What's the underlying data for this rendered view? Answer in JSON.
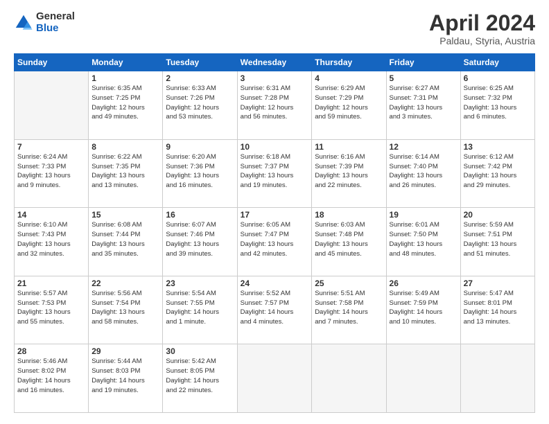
{
  "logo": {
    "general": "General",
    "blue": "Blue"
  },
  "title": "April 2024",
  "subtitle": "Paldau, Styria, Austria",
  "days_header": [
    "Sunday",
    "Monday",
    "Tuesday",
    "Wednesday",
    "Thursday",
    "Friday",
    "Saturday"
  ],
  "weeks": [
    [
      {
        "num": "",
        "info": ""
      },
      {
        "num": "1",
        "info": "Sunrise: 6:35 AM\nSunset: 7:25 PM\nDaylight: 12 hours\nand 49 minutes."
      },
      {
        "num": "2",
        "info": "Sunrise: 6:33 AM\nSunset: 7:26 PM\nDaylight: 12 hours\nand 53 minutes."
      },
      {
        "num": "3",
        "info": "Sunrise: 6:31 AM\nSunset: 7:28 PM\nDaylight: 12 hours\nand 56 minutes."
      },
      {
        "num": "4",
        "info": "Sunrise: 6:29 AM\nSunset: 7:29 PM\nDaylight: 12 hours\nand 59 minutes."
      },
      {
        "num": "5",
        "info": "Sunrise: 6:27 AM\nSunset: 7:31 PM\nDaylight: 13 hours\nand 3 minutes."
      },
      {
        "num": "6",
        "info": "Sunrise: 6:25 AM\nSunset: 7:32 PM\nDaylight: 13 hours\nand 6 minutes."
      }
    ],
    [
      {
        "num": "7",
        "info": "Sunrise: 6:24 AM\nSunset: 7:33 PM\nDaylight: 13 hours\nand 9 minutes."
      },
      {
        "num": "8",
        "info": "Sunrise: 6:22 AM\nSunset: 7:35 PM\nDaylight: 13 hours\nand 13 minutes."
      },
      {
        "num": "9",
        "info": "Sunrise: 6:20 AM\nSunset: 7:36 PM\nDaylight: 13 hours\nand 16 minutes."
      },
      {
        "num": "10",
        "info": "Sunrise: 6:18 AM\nSunset: 7:37 PM\nDaylight: 13 hours\nand 19 minutes."
      },
      {
        "num": "11",
        "info": "Sunrise: 6:16 AM\nSunset: 7:39 PM\nDaylight: 13 hours\nand 22 minutes."
      },
      {
        "num": "12",
        "info": "Sunrise: 6:14 AM\nSunset: 7:40 PM\nDaylight: 13 hours\nand 26 minutes."
      },
      {
        "num": "13",
        "info": "Sunrise: 6:12 AM\nSunset: 7:42 PM\nDaylight: 13 hours\nand 29 minutes."
      }
    ],
    [
      {
        "num": "14",
        "info": "Sunrise: 6:10 AM\nSunset: 7:43 PM\nDaylight: 13 hours\nand 32 minutes."
      },
      {
        "num": "15",
        "info": "Sunrise: 6:08 AM\nSunset: 7:44 PM\nDaylight: 13 hours\nand 35 minutes."
      },
      {
        "num": "16",
        "info": "Sunrise: 6:07 AM\nSunset: 7:46 PM\nDaylight: 13 hours\nand 39 minutes."
      },
      {
        "num": "17",
        "info": "Sunrise: 6:05 AM\nSunset: 7:47 PM\nDaylight: 13 hours\nand 42 minutes."
      },
      {
        "num": "18",
        "info": "Sunrise: 6:03 AM\nSunset: 7:48 PM\nDaylight: 13 hours\nand 45 minutes."
      },
      {
        "num": "19",
        "info": "Sunrise: 6:01 AM\nSunset: 7:50 PM\nDaylight: 13 hours\nand 48 minutes."
      },
      {
        "num": "20",
        "info": "Sunrise: 5:59 AM\nSunset: 7:51 PM\nDaylight: 13 hours\nand 51 minutes."
      }
    ],
    [
      {
        "num": "21",
        "info": "Sunrise: 5:57 AM\nSunset: 7:53 PM\nDaylight: 13 hours\nand 55 minutes."
      },
      {
        "num": "22",
        "info": "Sunrise: 5:56 AM\nSunset: 7:54 PM\nDaylight: 13 hours\nand 58 minutes."
      },
      {
        "num": "23",
        "info": "Sunrise: 5:54 AM\nSunset: 7:55 PM\nDaylight: 14 hours\nand 1 minute."
      },
      {
        "num": "24",
        "info": "Sunrise: 5:52 AM\nSunset: 7:57 PM\nDaylight: 14 hours\nand 4 minutes."
      },
      {
        "num": "25",
        "info": "Sunrise: 5:51 AM\nSunset: 7:58 PM\nDaylight: 14 hours\nand 7 minutes."
      },
      {
        "num": "26",
        "info": "Sunrise: 5:49 AM\nSunset: 7:59 PM\nDaylight: 14 hours\nand 10 minutes."
      },
      {
        "num": "27",
        "info": "Sunrise: 5:47 AM\nSunset: 8:01 PM\nDaylight: 14 hours\nand 13 minutes."
      }
    ],
    [
      {
        "num": "28",
        "info": "Sunrise: 5:46 AM\nSunset: 8:02 PM\nDaylight: 14 hours\nand 16 minutes."
      },
      {
        "num": "29",
        "info": "Sunrise: 5:44 AM\nSunset: 8:03 PM\nDaylight: 14 hours\nand 19 minutes."
      },
      {
        "num": "30",
        "info": "Sunrise: 5:42 AM\nSunset: 8:05 PM\nDaylight: 14 hours\nand 22 minutes."
      },
      {
        "num": "",
        "info": ""
      },
      {
        "num": "",
        "info": ""
      },
      {
        "num": "",
        "info": ""
      },
      {
        "num": "",
        "info": ""
      }
    ]
  ]
}
